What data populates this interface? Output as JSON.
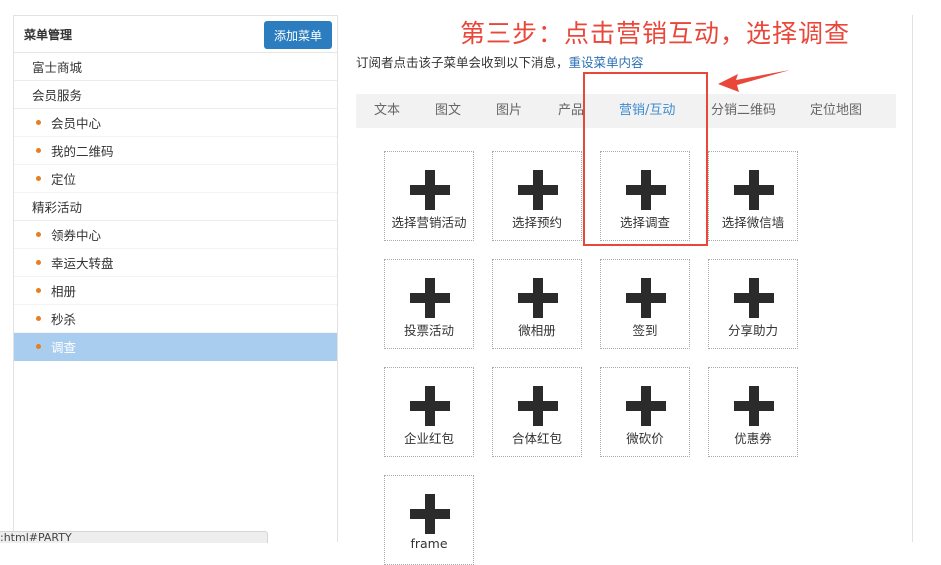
{
  "sidebar": {
    "title": "菜单管理",
    "add_button": "添加菜单",
    "items": [
      {
        "label": "富士商城",
        "level": "top"
      },
      {
        "label": "会员服务",
        "level": "top"
      },
      {
        "label": "会员中心",
        "level": "sub"
      },
      {
        "label": "我的二维码",
        "level": "sub"
      },
      {
        "label": "定位",
        "level": "sub"
      },
      {
        "label": "精彩活动",
        "level": "top"
      },
      {
        "label": "领券中心",
        "level": "sub"
      },
      {
        "label": "幸运大转盘",
        "level": "sub"
      },
      {
        "label": "相册",
        "level": "sub"
      },
      {
        "label": "秒杀",
        "level": "sub"
      },
      {
        "label": "调查",
        "level": "sub",
        "selected": true
      }
    ]
  },
  "annotation": {
    "step_text": "第三步：点击营销互动，选择调查"
  },
  "hint": {
    "text": "订阅者点击该子菜单会收到以下消息，",
    "link": "重设菜单内容"
  },
  "tabs": [
    {
      "label": "文本"
    },
    {
      "label": "图文"
    },
    {
      "label": "图片"
    },
    {
      "label": "产品"
    },
    {
      "label": "营销/互动",
      "active": true
    },
    {
      "label": "分销二维码"
    },
    {
      "label": "定位地图"
    }
  ],
  "cards": [
    {
      "label": "选择营销活动"
    },
    {
      "label": "选择预约"
    },
    {
      "label": "选择调查"
    },
    {
      "label": "选择微信墙"
    },
    {
      "label": "投票活动"
    },
    {
      "label": "微相册"
    },
    {
      "label": "签到"
    },
    {
      "label": "分享助力"
    },
    {
      "label": "企业红包"
    },
    {
      "label": "合体红包"
    },
    {
      "label": "微砍价"
    },
    {
      "label": "优惠券"
    },
    {
      "label": "frame"
    }
  ],
  "status_bar": {
    "text": ":html#PARTY"
  },
  "colors": {
    "accent": "#2c7dc0",
    "annotation_red": "#e8473a",
    "selected_row": "#a9cdee",
    "bullet": "#e67e22"
  }
}
